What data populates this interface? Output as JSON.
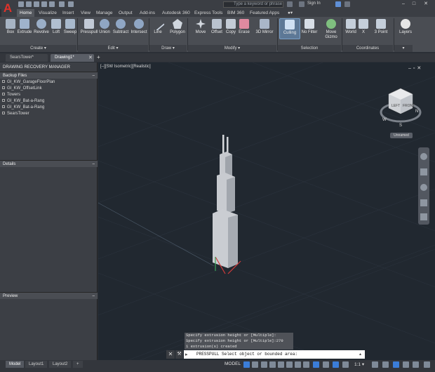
{
  "titlebar": {
    "search_placeholder": "Type a keyword or phrase",
    "sign_in": "Sign In",
    "minimize": "–",
    "maximize": "□",
    "close": "✕"
  },
  "ribbon_tabs": [
    "Home",
    "Visualize",
    "Insert",
    "View",
    "Manage",
    "Output",
    "Add-ins",
    "Autodesk 360",
    "Express Tools",
    "BIM 360",
    "Featured Apps"
  ],
  "ribbon_tools": {
    "box": "Box",
    "extrude": "Extrude",
    "revolve": "Revolve",
    "loft": "Loft",
    "sweep": "Sweep",
    "presspull": "Presspull",
    "union": "Union",
    "subtract": "Subtract",
    "intersect": "Intersect",
    "line": "Line",
    "polygon": "Polygon",
    "move": "Move",
    "offset": "Offset",
    "copy": "Copy",
    "erase": "Erase",
    "mirror3d": "3D Mirror",
    "culling": "Culling",
    "no_filter": "No Filter",
    "move_gizmo": "Move Gizmo",
    "world": "World",
    "x": "X",
    "three_point": "3 Point",
    "layers": "Layers"
  },
  "ribbon_panels": {
    "create": "Create ▾",
    "edit": "Edit ▾",
    "draw": "Draw ▾",
    "modify": "Modify ▾",
    "selection": "Selection",
    "coordinates": "Coordinates"
  },
  "file_tabs": [
    "SearsTower*",
    "Drawing1*"
  ],
  "left_panel": {
    "title": "DRAWING RECOVERY MANAGER",
    "backup_header": "Backup Files",
    "backup_files": [
      "GI_KW_GarageFloorPlan",
      "GI_KW_OffsetLink",
      "Towers",
      "GI_KW_Bat-a-Rang",
      "GI_KW_Bat-a-Rang",
      "SearsTower"
    ],
    "details": "Details",
    "preview": "Preview"
  },
  "viewport": {
    "label": "[–][SW Isometric][Realistic]",
    "viewcube_label": "Unnamed",
    "compass_n": "N",
    "compass_w": "W",
    "compass_s": "S"
  },
  "command": {
    "history": [
      "Specify extrusion height or [Multiple]:",
      "Specify extrusion height or [Multiple]:270",
      "1 extrusion(s) created"
    ],
    "input_text": "PRESSPULL Select object or bounded area:",
    "close": "✕",
    "wrench": "🔧"
  },
  "layout_tabs": [
    "Model",
    "Layout1",
    "Layout2",
    "+"
  ],
  "statusbar": {
    "model": "MODEL",
    "scale": "1:1 ▾"
  },
  "colors": {
    "accent_blue": "#3b7dd8",
    "app_red": "#e0322a",
    "viewport_bg": "#212830",
    "tower": "#c9ccd1"
  }
}
